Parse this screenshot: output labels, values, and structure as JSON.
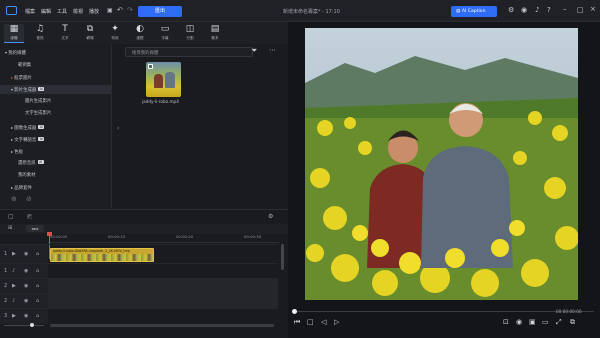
{
  "titlebar": {
    "menus": [
      "檔案",
      "編輯",
      "工具",
      "檢視",
      "播放"
    ],
    "export_label": "匯出",
    "project_title": "新增未命名專案* - 17:10",
    "ai_caption_label": "AI Caption"
  },
  "toolbar": {
    "tools": [
      {
        "label": "媒體",
        "icon": "media-icon"
      },
      {
        "label": "音訊",
        "icon": "audio-icon"
      },
      {
        "label": "文字",
        "icon": "text-icon"
      },
      {
        "label": "轉場",
        "icon": "transition-icon"
      },
      {
        "label": "特效",
        "icon": "effects-icon"
      },
      {
        "label": "濾鏡",
        "icon": "filter-icon"
      },
      {
        "label": "字幕",
        "icon": "caption-icon"
      },
      {
        "label": "分割",
        "icon": "split-icon"
      },
      {
        "label": "範本",
        "icon": "template-icon"
      }
    ]
  },
  "sidebar": {
    "items": [
      {
        "label": "我的媒體",
        "badge": ""
      },
      {
        "label": "範例集",
        "badge": ""
      },
      {
        "label": "股票圖片",
        "badge": ""
      },
      {
        "label": "影片生成器",
        "badge": "AI"
      },
      {
        "label": "圖片生成影片",
        "badge": ""
      },
      {
        "label": "文字生成影片",
        "badge": ""
      },
      {
        "label": "圖像生成器",
        "badge": "AI"
      },
      {
        "label": "文字轉語音",
        "badge": "AI"
      },
      {
        "label": "色板",
        "badge": ""
      },
      {
        "label": "還原音訊",
        "badge": "AI"
      },
      {
        "label": "我的素材",
        "badge": ""
      },
      {
        "label": "品牌套件",
        "badge": ""
      }
    ]
  },
  "media_panel": {
    "search_placeholder": "搜尋我的媒體",
    "clip_name": "jaddy-li-robo.mp4"
  },
  "timeline": {
    "times": [
      "00:00:00",
      "00:00:10",
      "00:00:20",
      "00:00:30"
    ],
    "clip_label": "jaddy-li-robo-Ds8XPA-unsplash_1_2K.MOV_tmp"
  },
  "preview": {
    "timecode": "00:00:00:00"
  }
}
